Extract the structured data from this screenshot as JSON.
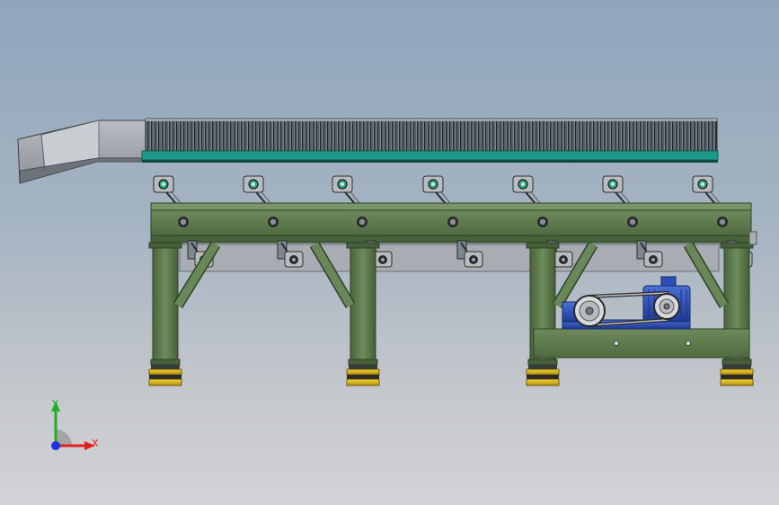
{
  "viewport": {
    "background_top": "#8fa6bc",
    "background_bottom": "#d3d3d6"
  },
  "model": {
    "frame_color": "#5e7a4e",
    "frame_dark": "#3f5534",
    "belt_teal": "#1f9a8a",
    "motor_blue": "#2c4fb8",
    "foot_yellow": "#e8c21a"
  },
  "triad": {
    "x_label": "X",
    "y_label": "Y",
    "x_color": "#e02020",
    "y_color": "#20b020",
    "z_color": "#2030e0"
  }
}
